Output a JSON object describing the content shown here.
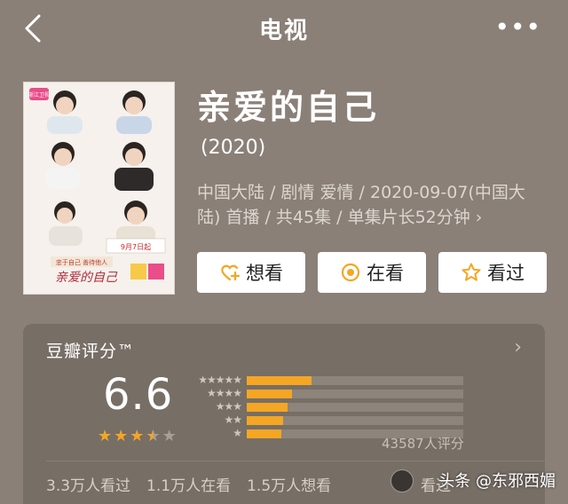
{
  "nav": {
    "title": "电视",
    "more": "•••"
  },
  "show": {
    "title": "亲爱的自己",
    "year": "(2020)",
    "meta": "中国大陆 / 剧情 爱情 / 2020-09-07(中国大陆) 首播 / 共45集 / 单集片长52分钟",
    "meta_chevron": "›"
  },
  "actions": [
    {
      "label": "想看",
      "icon": "heart-plus-icon"
    },
    {
      "label": "在看",
      "icon": "target-icon"
    },
    {
      "label": "看过",
      "icon": "star-outline-icon"
    }
  ],
  "poster": {
    "badge": "浙江卫视",
    "date": "9月7日起",
    "slogan": "忠于自己 善待他人",
    "title": "亲爱的自己"
  },
  "rating": {
    "header": "豆瓣评分™",
    "chevron": "›",
    "score": "6.6",
    "stars": 3.5,
    "distribution": [
      {
        "stars": "★★★★★",
        "fraction": 0.3
      },
      {
        "stars": "★★★★",
        "fraction": 0.21
      },
      {
        "stars": "★★★",
        "fraction": 0.19
      },
      {
        "stars": "★★",
        "fraction": 0.17
      },
      {
        "stars": "★",
        "fraction": 0.16
      }
    ],
    "count": "43587人评分"
  },
  "stats": {
    "watched": "3.3万人看过",
    "watching": "1.1万人在看",
    "want": "1.5万人想看",
    "friends_watched": "看过"
  },
  "watermark": "头条 @东邪西媚"
}
